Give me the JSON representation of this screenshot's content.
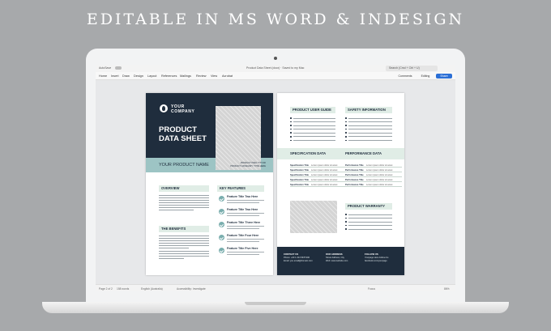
{
  "headline": "EDITABLE IN MS WORD & INDESIGN",
  "word": {
    "titlebar": {
      "autosave": "AutoSave",
      "doc_title": "Product Data Sheet (docx) · Saved to my Mac",
      "search": "Search (Cmd + Ctrl + U)"
    },
    "ribbon_tabs": [
      "Home",
      "Insert",
      "Draw",
      "Design",
      "Layout",
      "References",
      "Mailings",
      "Review",
      "View",
      "Acrobat"
    ],
    "ribbon_buttons": {
      "comments": "Comments",
      "editing": "Editing",
      "share": "Share"
    },
    "status": {
      "page": "Page 2 of 2",
      "words": "158 words",
      "language": "English (Australia)",
      "accessibility": "Accessibility: Investigate",
      "focus": "Focus",
      "zoom": "86%"
    }
  },
  "page1": {
    "company": "YOUR COMPANY",
    "title_line1": "PRODUCT",
    "title_line2": "DATA SHEET",
    "product_name": "YOUR PRODUCT NAME",
    "product_meta_1": "PRODUCT ITEM: TYP 000",
    "product_meta_2": "PRODUCT CATEGORY: TYPE HERE",
    "overview": "OVERVIEW",
    "key_features": "KEY FEATURES",
    "benefits": "THE BENEFITS",
    "features": [
      "Feature Title Two Here",
      "Feature Title Two Here",
      "Feature Title Three Here",
      "Feature Title Four Here",
      "Feature Title Five Here"
    ]
  },
  "page2": {
    "user_guide": "PRODUCT USER GUIDE",
    "safety": "SAFETY INFORMATION",
    "spec_data": "SPECIFICATION DATA",
    "performance": "PERFORMANCE DATA",
    "spec_key": "Specification Title",
    "perf_key": "Performance Title",
    "row_value": "Lorem ipsum dolor sit amet",
    "warranty": "PRODUCT WARRANTY",
    "footer": {
      "contact_title": "CONTACT US",
      "contact_phone": "Phone: +00 1 234 5678 900",
      "contact_email": "Email: you.email@domain.com",
      "address_title": "OUR ADDRESS",
      "address_street": "Street Address, City",
      "address_web": "Web: www.website.com",
      "follow_title": "FOLLOW US",
      "follow_handle": "Yourpage Here Follow Us",
      "follow_link": "facebook.com/yourpage"
    }
  },
  "colors": {
    "navy": "#1f2d3d",
    "teal": "#9dc4c4",
    "mint": "#e0ede6",
    "accent": "#7aaeae"
  }
}
